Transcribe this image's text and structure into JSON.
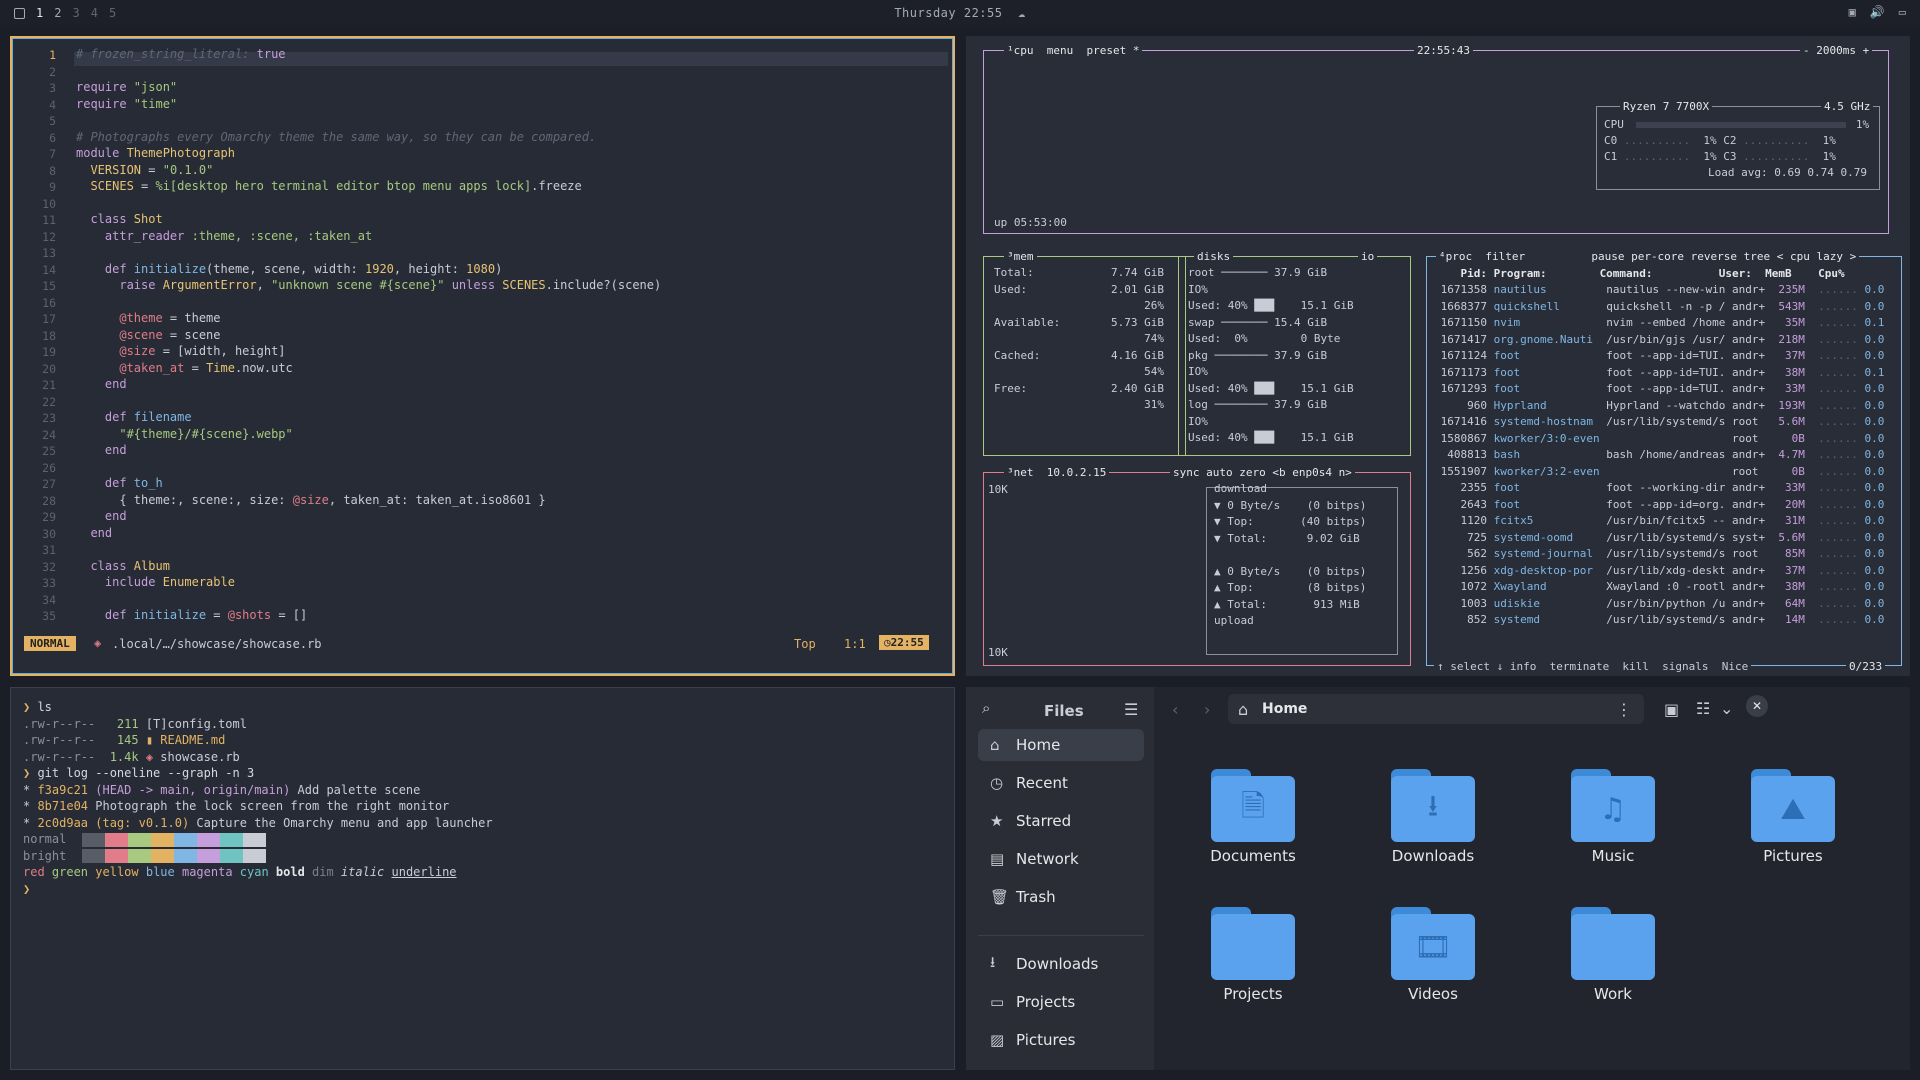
{
  "topbar": {
    "workspaces": [
      "1",
      "2",
      "3",
      "4",
      "5"
    ],
    "clock": "Thursday 22:55",
    "weather_icon": "cloud-icon"
  },
  "nvim": {
    "lines": [
      {
        "n": "1",
        "parts": [
          [
            "cm",
            "# frozen_string_literal: "
          ],
          [
            "kw",
            "true"
          ]
        ]
      },
      {
        "n": "2",
        "parts": []
      },
      {
        "n": "3",
        "parts": [
          [
            "kw",
            "require "
          ],
          [
            "str",
            "\"json\""
          ]
        ]
      },
      {
        "n": "4",
        "parts": [
          [
            "kw",
            "require "
          ],
          [
            "str",
            "\"time\""
          ]
        ]
      },
      {
        "n": "5",
        "parts": []
      },
      {
        "n": "6",
        "parts": [
          [
            "cm",
            "# Photographs every Omarchy theme the same way, so they can be compared."
          ]
        ]
      },
      {
        "n": "7",
        "parts": [
          [
            "kw",
            "module "
          ],
          [
            "cn",
            "ThemePhotograph"
          ]
        ]
      },
      {
        "n": "8",
        "parts": [
          [
            "cn",
            "  VERSION"
          ],
          [
            "tx",
            " = "
          ],
          [
            "str",
            "\"0.1.0\""
          ]
        ]
      },
      {
        "n": "9",
        "parts": [
          [
            "cn",
            "  SCENES"
          ],
          [
            "tx",
            " = "
          ],
          [
            "str",
            "%i[desktop hero terminal editor btop menu apps lock]"
          ],
          [
            "tx",
            ".freeze"
          ]
        ]
      },
      {
        "n": "10",
        "parts": []
      },
      {
        "n": "11",
        "parts": [
          [
            "kw",
            "  class "
          ],
          [
            "cn",
            "Shot"
          ]
        ]
      },
      {
        "n": "12",
        "parts": [
          [
            "kw",
            "    attr_reader "
          ],
          [
            "str",
            ":theme, :scene, :taken_at"
          ]
        ]
      },
      {
        "n": "13",
        "parts": []
      },
      {
        "n": "14",
        "parts": [
          [
            "kw",
            "    def "
          ],
          [
            "fn",
            "initialize"
          ],
          [
            "tx",
            "(theme, scene, width: "
          ],
          [
            "cn",
            "1920"
          ],
          [
            "tx",
            ", height: "
          ],
          [
            "cn",
            "1080"
          ],
          [
            "tx",
            ")"
          ]
        ]
      },
      {
        "n": "15",
        "parts": [
          [
            "kw",
            "      raise "
          ],
          [
            "cn",
            "ArgumentError"
          ],
          [
            "tx",
            ", "
          ],
          [
            "str",
            "\"unknown scene #{scene}\""
          ],
          [
            "kw",
            " unless "
          ],
          [
            "cn",
            "SCENES"
          ],
          [
            "tx",
            ".include?(scene)"
          ]
        ]
      },
      {
        "n": "16",
        "parts": []
      },
      {
        "n": "17",
        "parts": [
          [
            "iv",
            "      @theme"
          ],
          [
            "tx",
            " = theme"
          ]
        ]
      },
      {
        "n": "18",
        "parts": [
          [
            "iv",
            "      @scene"
          ],
          [
            "tx",
            " = scene"
          ]
        ]
      },
      {
        "n": "19",
        "parts": [
          [
            "iv",
            "      @size"
          ],
          [
            "tx",
            " = [width, height]"
          ]
        ]
      },
      {
        "n": "20",
        "parts": [
          [
            "iv",
            "      @taken_at"
          ],
          [
            "tx",
            " = "
          ],
          [
            "cn",
            "Time"
          ],
          [
            "tx",
            ".now.utc"
          ]
        ]
      },
      {
        "n": "21",
        "parts": [
          [
            "kw",
            "    end"
          ]
        ]
      },
      {
        "n": "22",
        "parts": []
      },
      {
        "n": "23",
        "parts": [
          [
            "kw",
            "    def "
          ],
          [
            "fn",
            "filename"
          ]
        ]
      },
      {
        "n": "24",
        "parts": [
          [
            "str",
            "      \"#{theme}/#{scene}.webp\""
          ]
        ]
      },
      {
        "n": "25",
        "parts": [
          [
            "kw",
            "    end"
          ]
        ]
      },
      {
        "n": "26",
        "parts": []
      },
      {
        "n": "27",
        "parts": [
          [
            "kw",
            "    def "
          ],
          [
            "fn",
            "to_h"
          ]
        ]
      },
      {
        "n": "28",
        "parts": [
          [
            "tx",
            "      { theme:, scene:, size: "
          ],
          [
            "iv",
            "@size"
          ],
          [
            "tx",
            ", taken_at: taken_at.iso8601 }"
          ]
        ]
      },
      {
        "n": "29",
        "parts": [
          [
            "kw",
            "    end"
          ]
        ]
      },
      {
        "n": "30",
        "parts": [
          [
            "kw",
            "  end"
          ]
        ]
      },
      {
        "n": "31",
        "parts": []
      },
      {
        "n": "32",
        "parts": [
          [
            "kw",
            "  class "
          ],
          [
            "cn",
            "Album"
          ]
        ]
      },
      {
        "n": "33",
        "parts": [
          [
            "kw",
            "    include "
          ],
          [
            "cn",
            "Enumerable"
          ]
        ]
      },
      {
        "n": "34",
        "parts": []
      },
      {
        "n": "35",
        "parts": [
          [
            "kw",
            "    def "
          ],
          [
            "fn",
            "initialize"
          ],
          [
            "tx",
            " = "
          ],
          [
            "iv",
            "@shots"
          ],
          [
            "tx",
            " = []"
          ]
        ]
      }
    ],
    "mode": "NORMAL",
    "path": ".local/…/showcase/showcase.rb",
    "pos_top": "Top",
    "cursor": "1:1",
    "time": "22:55"
  },
  "btop": {
    "cpu": {
      "title": "cpu",
      "menu": "menu",
      "preset": "preset *",
      "time": "22:55:43",
      "interval": "- 2000ms +",
      "model": "Ryzen 7 7700X",
      "freq": "4.5 GHz",
      "rows": [
        [
          "CPU",
          "",
          "1%"
        ],
        [
          "C0",
          "1%",
          "C2",
          "1%"
        ],
        [
          "C1",
          "1%",
          "C3",
          "1%"
        ]
      ],
      "load": "Load avg: 0.69 0.74 0.79",
      "uptime": "up 05:53:00"
    },
    "mem": {
      "title": "mem",
      "rows": [
        [
          "Total:",
          "7.74 GiB"
        ],
        [
          "Used:",
          "2.01 GiB"
        ],
        [
          "",
          "26%"
        ],
        [
          "Available:",
          "5.73 GiB"
        ],
        [
          "",
          "74%"
        ],
        [
          "Cached:",
          "4.16 GiB"
        ],
        [
          "",
          "54%"
        ],
        [
          "Free:",
          "2.40 GiB"
        ],
        [
          "",
          "31%"
        ]
      ]
    },
    "disks": {
      "title": "disks",
      "io": "io",
      "rows": [
        "root ─────── 37.9 GiB",
        "IO%",
        "Used: 40% ███    15.1 GiB",
        "swap ─────── 15.4 GiB",
        "Used:  0%        0 Byte",
        "pkg ──────── 37.9 GiB",
        "IO%",
        "Used: 40% ███    15.1 GiB",
        "log ──────── 37.9 GiB",
        "IO%",
        "Used: 40% ███    15.1 GiB"
      ]
    },
    "net": {
      "title": "net",
      "ip": "10.0.2.15",
      "opts": "sync auto zero <b enp0s4 n>",
      "scale_top": "10K",
      "scale_bot": "10K",
      "rows": [
        "download",
        "▼ 0 Byte/s    (0 bitps)",
        "▼ Top:       (40 bitps)",
        "▼ Total:      9.02 GiB",
        "",
        "▲ 0 Byte/s    (0 bitps)",
        "▲ Top:        (8 bitps)",
        "▲ Total:       913 MiB",
        "upload"
      ]
    },
    "proc": {
      "title": "proc",
      "header": "filter          pause per-core reverse tree < cpu lazy >",
      "cols": "    Pid: Program:        Command:          User:  MemB    Cpu%",
      "rows": [
        [
          "1671358",
          "nautilus",
          "nautilus --new-win",
          "andr+",
          "235M",
          "0.0"
        ],
        [
          "1668377",
          "quickshell",
          "quickshell -n -p /",
          "andr+",
          "543M",
          "0.0"
        ],
        [
          "1671150",
          "nvim",
          "nvim --embed /home",
          "andr+",
          "35M",
          "0.1"
        ],
        [
          "1671417",
          "org.gnome.Nauti",
          "/usr/bin/gjs /usr/",
          "andr+",
          "218M",
          "0.0"
        ],
        [
          "1671124",
          "foot",
          "foot --app-id=TUI.",
          "andr+",
          "37M",
          "0.0"
        ],
        [
          "1671173",
          "foot",
          "foot --app-id=TUI.",
          "andr+",
          "38M",
          "0.1"
        ],
        [
          "1671293",
          "foot",
          "foot --app-id=TUI.",
          "andr+",
          "33M",
          "0.0"
        ],
        [
          "960",
          "Hyprland",
          "Hyprland --watchdo",
          "andr+",
          "193M",
          "0.0"
        ],
        [
          "1671416",
          "systemd-hostnam",
          "/usr/lib/systemd/s",
          "root",
          "5.6M",
          "0.0"
        ],
        [
          "1580867",
          "kworker/3:0-even",
          "",
          "root",
          "0B",
          "0.0"
        ],
        [
          "408813",
          "bash",
          "bash /home/andreas",
          "andr+",
          "4.7M",
          "0.0"
        ],
        [
          "1551907",
          "kworker/3:2-even",
          "",
          "root",
          "0B",
          "0.0"
        ],
        [
          "2355",
          "foot",
          "foot --working-dir",
          "andr+",
          "33M",
          "0.0"
        ],
        [
          "2643",
          "foot",
          "foot --app-id=org.",
          "andr+",
          "20M",
          "0.0"
        ],
        [
          "1120",
          "fcitx5",
          "/usr/bin/fcitx5 --",
          "andr+",
          "31M",
          "0.0"
        ],
        [
          "725",
          "systemd-oomd",
          "/usr/lib/systemd/s",
          "syst+",
          "5.6M",
          "0.0"
        ],
        [
          "562",
          "systemd-journal",
          "/usr/lib/systemd/s",
          "root",
          "85M",
          "0.0"
        ],
        [
          "1256",
          "xdg-desktop-por",
          "/usr/lib/xdg-deskt",
          "andr+",
          "37M",
          "0.0"
        ],
        [
          "1072",
          "Xwayland",
          "Xwayland :0 -rootl",
          "andr+",
          "38M",
          "0.0"
        ],
        [
          "1003",
          "udiskie",
          "/usr/bin/python /u",
          "andr+",
          "64M",
          "0.0"
        ],
        [
          "852",
          "systemd",
          "/usr/lib/systemd/s",
          "andr+",
          "14M",
          "0.0"
        ]
      ],
      "footer": "↑ select ↓ info  terminate  kill  signals  Nice",
      "count": "0/233"
    }
  },
  "term": {
    "lines": [
      [
        [
          "#e3b263",
          "❯ "
        ],
        [
          "#d5d8df",
          "ls"
        ]
      ],
      [
        [
          "#8a909c",
          ".rw-r--r--  "
        ],
        [
          "#a7c980",
          " 211"
        ],
        [
          "#c9ccd4",
          " [T]config.toml"
        ]
      ],
      [
        [
          "#8a909c",
          ".rw-r--r--  "
        ],
        [
          "#a7c980",
          " 145"
        ],
        [
          "#e3b263",
          " ▮ README.md"
        ]
      ],
      [
        [
          "#8a909c",
          ".rw-r--r--  "
        ],
        [
          "#a7c980",
          "1.4k"
        ],
        [
          "#e07d88",
          " ◈ "
        ],
        [
          "#c9ccd4",
          "showcase.rb"
        ]
      ],
      [
        [
          "#e3b263",
          "❯ "
        ],
        [
          "#d5d8df",
          "git log --oneline --graph -n 3"
        ]
      ],
      [
        [
          "#c9ccd4",
          "* "
        ],
        [
          "#e3b263",
          "f3a9c21 "
        ],
        [
          "#c69edb",
          "(HEAD -> main, origin/main)"
        ],
        [
          "#c9ccd4",
          " Add palette scene"
        ]
      ],
      [
        [
          "#c9ccd4",
          "* "
        ],
        [
          "#e3b263",
          "8b71e04"
        ],
        [
          "#c9ccd4",
          " Photograph the lock screen from the right monitor"
        ]
      ],
      [
        [
          "#c9ccd4",
          "* "
        ],
        [
          "#e3b263",
          "2c0d9aa "
        ],
        [
          "#e3b263",
          "(tag: v0.1.0)"
        ],
        [
          "#c9ccd4",
          " Capture the Omarchy menu and app launcher"
        ]
      ],
      [
        [
          "#8a909c",
          "normal"
        ]
      ],
      [
        [
          "#8a909c",
          "bright"
        ]
      ],
      [
        [
          "#e07d88",
          "red "
        ],
        [
          "#a7c980",
          "green "
        ],
        [
          "#e3b263",
          "yellow "
        ],
        [
          "#7fb6e3",
          "blue "
        ],
        [
          "#c69edb",
          "magenta "
        ],
        [
          "#6fc3c0",
          "cyan "
        ],
        [
          "#e6e7ea",
          "bold "
        ],
        [
          "#7a808c",
          "dim "
        ],
        [
          "#c9ccd4",
          "italic "
        ],
        [
          "#c9ccd4",
          "underline"
        ]
      ],
      [
        [
          "#e3b263",
          "❯"
        ]
      ]
    ],
    "palette": [
      "#585c66",
      "#e07d88",
      "#a7c980",
      "#e3b263",
      "#7fb6e3",
      "#c69edb",
      "#6fc3c0",
      "#c9ccd4"
    ]
  },
  "files": {
    "title": "Files",
    "location": "Home",
    "sidebar": [
      {
        "label": "Home",
        "icon": "home-icon"
      },
      {
        "label": "Recent",
        "icon": "clock-icon"
      },
      {
        "label": "Starred",
        "icon": "star-icon"
      },
      {
        "label": "Network",
        "icon": "network-icon"
      },
      {
        "label": "Trash",
        "icon": "trash-icon"
      }
    ],
    "bookmarks": [
      {
        "label": "Downloads",
        "icon": "download-icon"
      },
      {
        "label": "Projects",
        "icon": "folder-icon"
      },
      {
        "label": "Pictures",
        "icon": "picture-icon"
      }
    ],
    "folders": [
      {
        "label": "Documents",
        "glyph": "🗎"
      },
      {
        "label": "Downloads",
        "glyph": "⭳"
      },
      {
        "label": "Music",
        "glyph": "♫"
      },
      {
        "label": "Pictures",
        "glyph": "⛰"
      },
      {
        "label": "Projects",
        "glyph": ""
      },
      {
        "label": "Videos",
        "glyph": "🎞"
      },
      {
        "label": "Work",
        "glyph": ""
      }
    ]
  }
}
